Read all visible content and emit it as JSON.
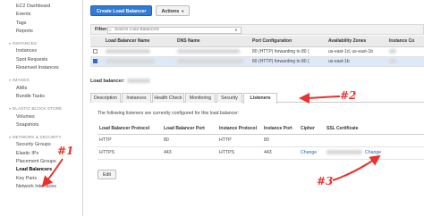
{
  "sidebar": {
    "items": [
      {
        "type": "link",
        "label": "EC2 Dashboard"
      },
      {
        "type": "link",
        "label": "Events"
      },
      {
        "type": "link",
        "label": "Tags"
      },
      {
        "type": "link",
        "label": "Reports"
      },
      {
        "type": "head",
        "label": "INSTANCES"
      },
      {
        "type": "link",
        "label": "Instances"
      },
      {
        "type": "link",
        "label": "Spot Requests"
      },
      {
        "type": "link",
        "label": "Reserved Instances"
      },
      {
        "type": "head",
        "label": "IMAGES"
      },
      {
        "type": "link",
        "label": "AMIs"
      },
      {
        "type": "link",
        "label": "Bundle Tasks"
      },
      {
        "type": "head",
        "label": "ELASTIC BLOCK STORE"
      },
      {
        "type": "link",
        "label": "Volumes"
      },
      {
        "type": "link",
        "label": "Snapshots"
      },
      {
        "type": "head",
        "label": "NETWORK & SECURITY"
      },
      {
        "type": "link",
        "label": "Security Groups"
      },
      {
        "type": "link",
        "label": "Elastic IPs"
      },
      {
        "type": "link",
        "label": "Placement Groups"
      },
      {
        "type": "link",
        "label": "Load Balancers",
        "active": true
      },
      {
        "type": "link",
        "label": "Key Pairs"
      },
      {
        "type": "link",
        "label": "Network Interfaces"
      }
    ]
  },
  "toolbar": {
    "create_label": "Create Load Balancer",
    "actions_label": "Actions"
  },
  "filter": {
    "label": "Filter:",
    "placeholder": "Search Load Balancers"
  },
  "lb_table": {
    "headers": [
      "Load Balancer Name",
      "DNS Name",
      "Port Configuration",
      "Availability Zones",
      "Instance Co"
    ],
    "rows": [
      {
        "port": "80 (HTTP) forwarding to 80 (",
        "zones": "us-east-1d, us-east-1b",
        "selected": false
      },
      {
        "port": "80 (HTTP) forwarding to 80 (",
        "zones": "us-east-1b",
        "selected": true
      }
    ]
  },
  "details": {
    "label": "Load balancer:",
    "tabs": [
      "Description",
      "Instances",
      "Health Check",
      "Monitoring",
      "Security",
      "Listeners"
    ],
    "active_tab": "Listeners",
    "listener_desc": "The following listeners are currently configured for this load balancer:",
    "listener_headers": [
      "Load Balancer Protocol",
      "Load Balancer Port",
      "Instance Protocol",
      "Instance Port",
      "Cipher",
      "SSL Certificate"
    ],
    "listener_rows": [
      {
        "lb_protocol": "HTTP",
        "lb_port": "80",
        "inst_protocol": "HTTP",
        "inst_port": "80",
        "cipher": "",
        "cert": ""
      },
      {
        "lb_protocol": "HTTPS",
        "lb_port": "443",
        "inst_protocol": "HTTPS",
        "inst_port": "443",
        "cipher": "Change",
        "cert": "Change"
      }
    ],
    "edit_label": "Edit"
  },
  "annotations": {
    "a1": "#1",
    "a2": "#2",
    "a3": "#3",
    "color": "#e8322c"
  }
}
